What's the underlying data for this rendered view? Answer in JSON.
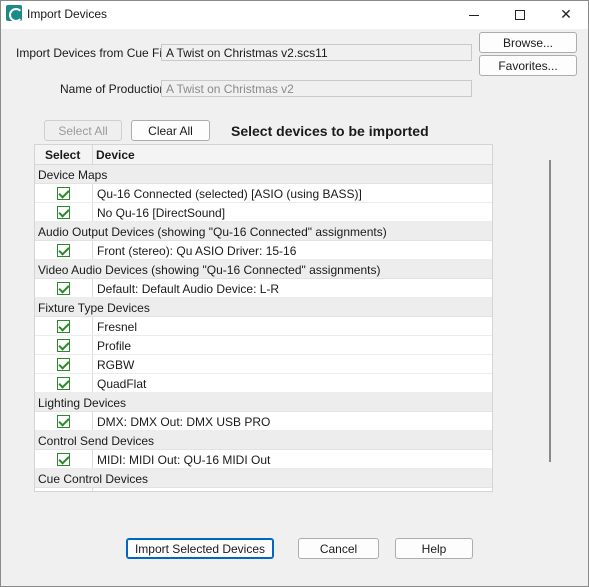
{
  "window": {
    "title": "Import Devices",
    "controls": {
      "minimize_icon": "minimize-icon",
      "maximize_icon": "maximize-icon",
      "close_icon": "close-icon"
    }
  },
  "form": {
    "cue_file_label": "Import Devices from Cue File",
    "cue_file_value": "A Twist on Christmas v2.scs11",
    "browse_label": "Browse...",
    "favorites_label": "Favorites...",
    "production_label": "Name of Production",
    "production_value": "A Twist on Christmas v2"
  },
  "selection": {
    "select_all_label": "Select All",
    "clear_all_label": "Clear All",
    "heading": "Select devices to be imported"
  },
  "grid": {
    "columns": {
      "select": "Select",
      "device": "Device"
    },
    "groups": [
      {
        "label": "Device Maps",
        "items": [
          {
            "name": "Qu-16 Connected (selected) [ASIO (using BASS)]",
            "checked": true
          },
          {
            "name": "No Qu-16 [DirectSound]",
            "checked": true
          }
        ]
      },
      {
        "label": "Audio Output Devices (showing \"Qu-16 Connected\" assignments)",
        "items": [
          {
            "name": "Front (stereo): Qu ASIO Driver: 15-16",
            "checked": true
          }
        ]
      },
      {
        "label": "Video Audio Devices (showing \"Qu-16 Connected\" assignments)",
        "items": [
          {
            "name": "Default: Default Audio Device: L-R",
            "checked": true
          }
        ]
      },
      {
        "label": "Fixture Type Devices",
        "items": [
          {
            "name": "Fresnel",
            "checked": true
          },
          {
            "name": "Profile",
            "checked": true
          },
          {
            "name": "RGBW",
            "checked": true
          },
          {
            "name": "QuadFlat",
            "checked": true
          }
        ]
      },
      {
        "label": "Lighting Devices",
        "items": [
          {
            "name": "DMX: DMX Out: DMX USB PRO",
            "checked": true
          }
        ]
      },
      {
        "label": "Control Send Devices",
        "items": [
          {
            "name": "MIDI: MIDI Out: QU-16 MIDI Out",
            "checked": true
          }
        ]
      },
      {
        "label": "Cue Control Devices",
        "items": []
      }
    ]
  },
  "footer": {
    "import_label": "Import Selected Devices",
    "cancel_label": "Cancel",
    "help_label": "Help"
  },
  "colors": {
    "accent": "#0067c0",
    "checkbox_green": "#2a8a2a"
  }
}
